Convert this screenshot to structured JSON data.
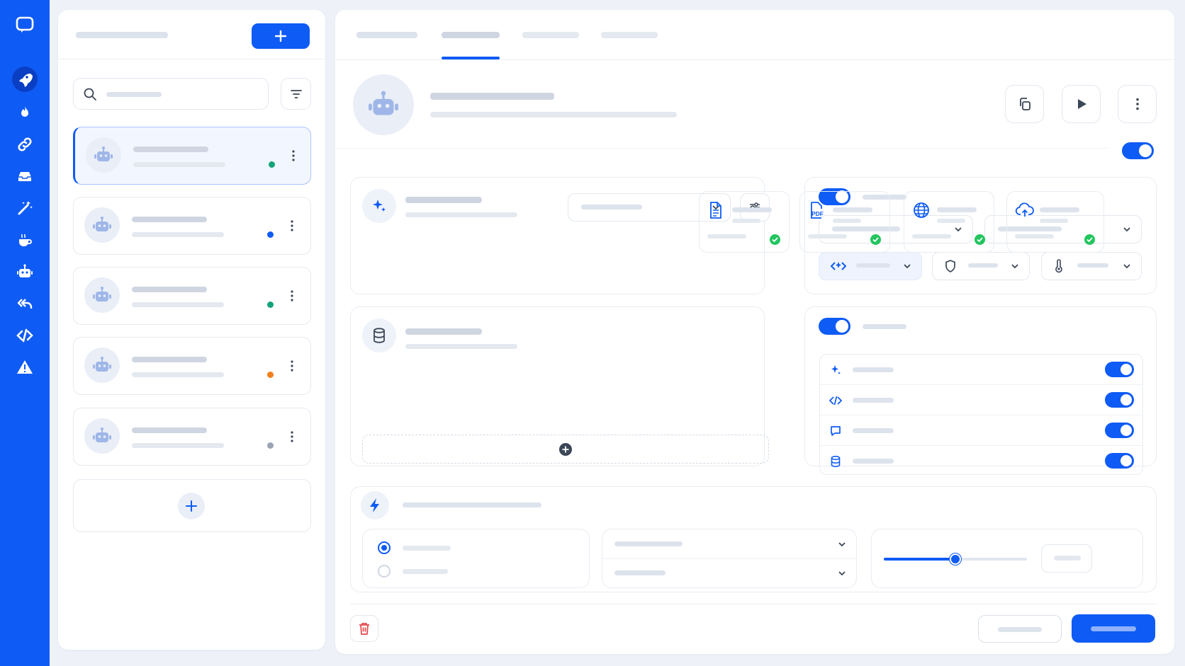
{
  "theme": {
    "accent": "#0f5bf5",
    "rail_active": "#0a3fc4",
    "status_green": "#16a37a",
    "status_blue": "#0f5bf5",
    "status_orange": "#f07f1c",
    "status_gray": "#9aa4b2",
    "success": "#22c55e",
    "danger": "#e5484d"
  },
  "rail": {
    "logo_icon": "chat-window-icon",
    "items": [
      {
        "icon": "rocket-icon",
        "active": true
      },
      {
        "icon": "flame-icon",
        "active": false
      },
      {
        "icon": "link-icon",
        "active": false
      },
      {
        "icon": "inbox-icon",
        "active": false
      },
      {
        "icon": "magic-wand-icon",
        "active": false
      },
      {
        "icon": "coffee-cup-icon",
        "active": false
      },
      {
        "icon": "robot-icon",
        "active": false
      },
      {
        "icon": "reply-all-icon",
        "active": false
      },
      {
        "icon": "code-icon",
        "active": false
      },
      {
        "icon": "warning-icon",
        "active": false
      }
    ]
  },
  "agents": {
    "items": [
      {
        "status": "green",
        "selected": true
      },
      {
        "status": "blue",
        "selected": false
      },
      {
        "status": "green",
        "selected": false
      },
      {
        "status": "orange",
        "selected": false
      },
      {
        "status": "gray",
        "selected": false
      }
    ]
  },
  "main": {
    "tabs_count": 4,
    "active_tab": 1,
    "enabled": true,
    "sources": [
      {
        "icon": "document-icon",
        "ok": true
      },
      {
        "icon": "pdf-icon",
        "ok": true
      },
      {
        "icon": "globe-icon",
        "ok": true
      },
      {
        "icon": "cloud-upload-icon",
        "ok": true
      }
    ],
    "capabilities": [
      {
        "icon": "sparkle-icon",
        "enabled": true
      },
      {
        "icon": "code-icon",
        "enabled": true
      },
      {
        "icon": "chat-bubble-icon",
        "enabled": true
      },
      {
        "icon": "database-icon",
        "enabled": true
      }
    ],
    "slider_value": 0.5
  }
}
